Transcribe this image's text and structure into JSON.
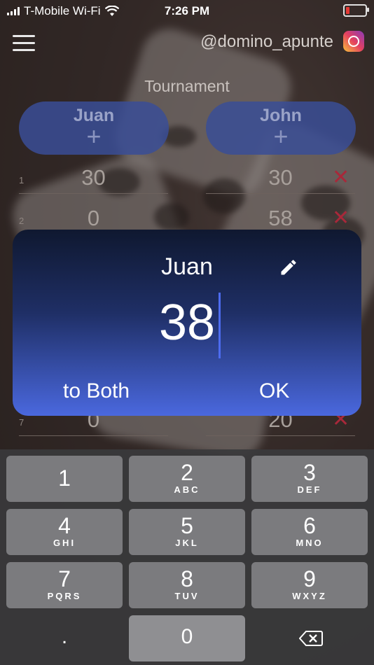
{
  "status_bar": {
    "carrier": "T-Mobile Wi-Fi",
    "time": "7:26 PM"
  },
  "header": {
    "handle": "@domino_apunte",
    "subtitle": "Tournament"
  },
  "teams": [
    {
      "name": "Juan",
      "add": "+"
    },
    {
      "name": "John",
      "add": "+"
    }
  ],
  "rows": [
    {
      "index": "1",
      "a": "30",
      "b": "30",
      "remove": "✕"
    },
    {
      "index": "2",
      "a": "0",
      "b": "58",
      "remove": "✕"
    },
    {
      "index": "7",
      "a": "0",
      "b": "20",
      "remove": "✕"
    }
  ],
  "dialog": {
    "player": "Juan",
    "value": "38",
    "to_both": "to Both",
    "ok": "OK"
  },
  "keypad": [
    {
      "num": "1",
      "letters": ""
    },
    {
      "num": "2",
      "letters": "ABC"
    },
    {
      "num": "3",
      "letters": "DEF"
    },
    {
      "num": "4",
      "letters": "GHI"
    },
    {
      "num": "5",
      "letters": "JKL"
    },
    {
      "num": "6",
      "letters": "MNO"
    },
    {
      "num": "7",
      "letters": "PQRS"
    },
    {
      "num": "8",
      "letters": "TUV"
    },
    {
      "num": "9",
      "letters": "WXYZ"
    },
    {
      "num": ".",
      "letters": ""
    },
    {
      "num": "0",
      "letters": ""
    }
  ]
}
